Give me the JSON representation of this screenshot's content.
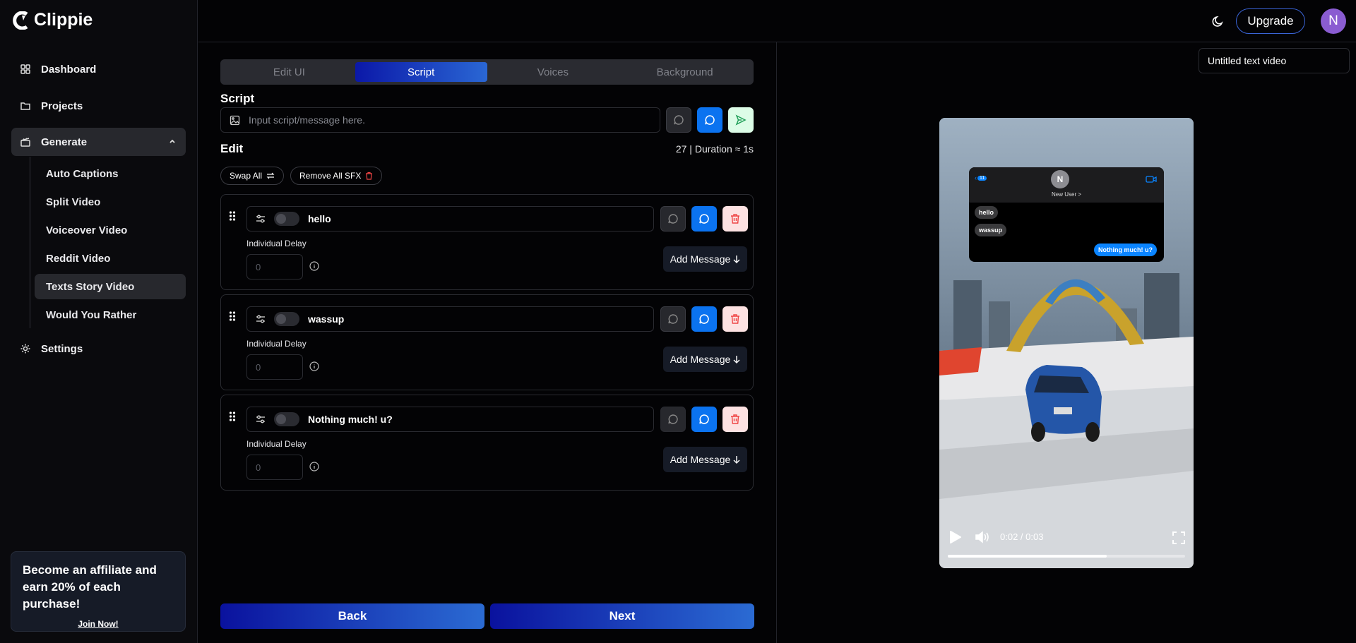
{
  "app": {
    "name": "Clippie"
  },
  "sidebar": {
    "items": [
      {
        "label": "Dashboard",
        "icon": "grid-icon"
      },
      {
        "label": "Projects",
        "icon": "folder-icon"
      },
      {
        "label": "Generate",
        "icon": "clapperboard-icon"
      },
      {
        "label": "Settings",
        "icon": "gear-icon"
      }
    ],
    "generate_items": [
      "Auto Captions",
      "Split Video",
      "Voiceover Video",
      "Reddit Video",
      "Texts Story Video",
      "Would You Rather"
    ],
    "active_sub": "Texts Story Video"
  },
  "affiliate": {
    "text": "Become an affiliate and earn 20% of each purchase!",
    "link": "Join Now!"
  },
  "header": {
    "upgrade": "Upgrade",
    "avatar_initial": "N"
  },
  "tabs": [
    {
      "label": "Edit UI",
      "active": false
    },
    {
      "label": "Script",
      "active": true
    },
    {
      "label": "Voices",
      "active": false
    },
    {
      "label": "Background",
      "active": false
    }
  ],
  "script": {
    "heading": "Script",
    "placeholder": "Input script/message here."
  },
  "edit": {
    "heading": "Edit",
    "duration": "27 | Duration ≈ 1s",
    "swap_all": "Swap All",
    "remove_sfx": "Remove All SFX"
  },
  "messages": [
    {
      "text": "hello",
      "delay_label": "Individual Delay",
      "delay_placeholder": "0",
      "add_label": "Add Message"
    },
    {
      "text": "wassup",
      "delay_label": "Individual Delay",
      "delay_placeholder": "0",
      "add_label": "Add Message"
    },
    {
      "text": "Nothing much! u?",
      "delay_label": "Individual Delay",
      "delay_placeholder": "0",
      "add_label": "Add Message"
    }
  ],
  "footer": {
    "back": "Back",
    "next": "Next"
  },
  "preview": {
    "title": "Untitled text video",
    "chat": {
      "contact_initial": "N",
      "contact_name": "New User >",
      "badge": "11",
      "bubbles": [
        {
          "text": "hello",
          "side": "in"
        },
        {
          "text": "wassup",
          "side": "in"
        },
        {
          "text": "Nothing much! u?",
          "side": "out"
        }
      ]
    },
    "time": "0:02 / 0:03",
    "progress": 0.67
  },
  "colors": {
    "accent": "#0b73f0",
    "gradient_start": "#0a129e",
    "gradient_end": "#2b6bd3"
  }
}
